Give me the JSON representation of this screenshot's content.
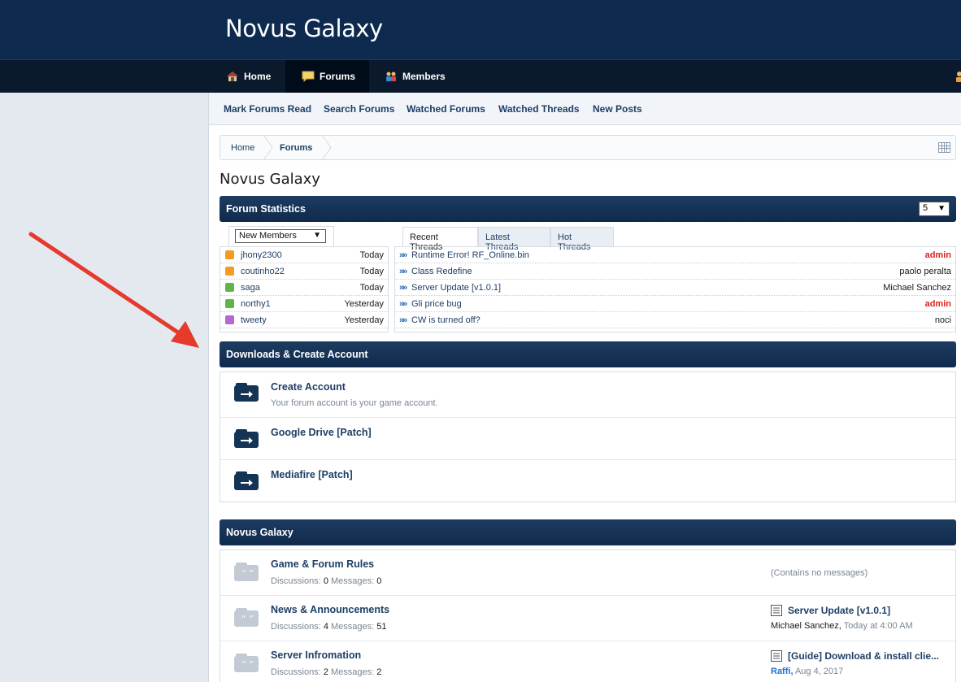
{
  "header": {
    "logo": "Novus Galaxy"
  },
  "nav": {
    "tabs": [
      {
        "label": "Home",
        "icon": "home-icon"
      },
      {
        "label": "Forums",
        "icon": "chat-bubble-icon",
        "active": true
      },
      {
        "label": "Members",
        "icon": "members-icon"
      }
    ]
  },
  "subnav": {
    "links": [
      "Mark Forums Read",
      "Search Forums",
      "Watched Forums",
      "Watched Threads",
      "New Posts"
    ]
  },
  "breadcrumb": {
    "items": [
      "Home",
      "Forums"
    ]
  },
  "page": {
    "title": "Novus Galaxy"
  },
  "stats": {
    "header": "Forum Statistics",
    "limit_value": "5",
    "members_dropdown": "New Members",
    "members": [
      {
        "name": "jhony2300",
        "date": "Today",
        "color": "#f39c1f"
      },
      {
        "name": "coutinho22",
        "date": "Today",
        "color": "#f39c1f"
      },
      {
        "name": "saga",
        "date": "Today",
        "color": "#5fb548"
      },
      {
        "name": "northy1",
        "date": "Yesterday",
        "color": "#5fb548"
      },
      {
        "name": "tweety",
        "date": "Yesterday",
        "color": "#b26ad1"
      }
    ],
    "thread_tabs": [
      "Recent Threads",
      "Latest Threads",
      "Hot Threads"
    ],
    "threads": [
      {
        "title": "Runtime Error! RF_Online.bin",
        "user": "admin",
        "staff": true
      },
      {
        "title": "Class Redefine",
        "user": "paolo peralta",
        "staff": false
      },
      {
        "title": "Server Update [v1.0.1]",
        "user": "Michael Sanchez",
        "staff": false
      },
      {
        "title": "Gli price bug",
        "user": "admin",
        "staff": true
      },
      {
        "title": "CW is turned off?",
        "user": "noci",
        "staff": false
      }
    ]
  },
  "downloads": {
    "header": "Downloads & Create Account",
    "items": [
      {
        "title": "Create Account",
        "desc": "Your forum account is your game account."
      },
      {
        "title": "Google Drive [Patch]",
        "desc": ""
      },
      {
        "title": "Mediafire [Patch]",
        "desc": ""
      }
    ]
  },
  "forums": {
    "header": "Novus Galaxy",
    "discussions_label": "Discussions:",
    "messages_label": "Messages:",
    "items": [
      {
        "title": "Game & Forum Rules",
        "discussions": "0",
        "messages": "0",
        "last_empty": "(Contains no messages)"
      },
      {
        "title": "News & Announcements",
        "discussions": "4",
        "messages": "51",
        "last_title": "Server Update [v1.0.1]",
        "last_user": "Michael Sanchez,",
        "last_date": "Today at 4:00 AM"
      },
      {
        "title": "Server Infromation",
        "discussions": "2",
        "messages": "2",
        "last_title": "[Guide] Download & install clie...",
        "last_user": "Raffi,",
        "last_date": "Aug 4, 2017"
      }
    ]
  },
  "colors": {
    "header_bg": "#0e2a4f",
    "staff_red": "#e0221b",
    "link": "#1d3f66",
    "annotation": "#e53a2c"
  }
}
